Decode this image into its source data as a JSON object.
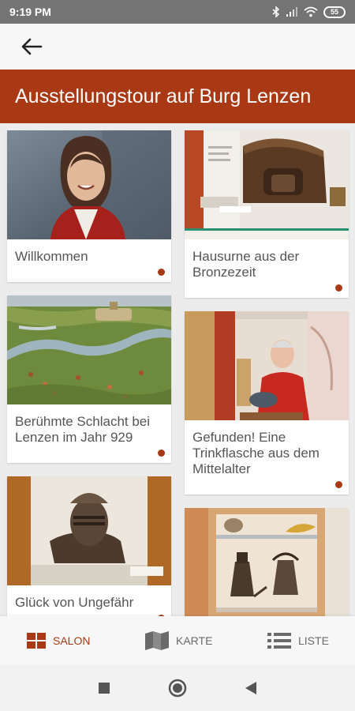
{
  "status_bar": {
    "time": "9:19 PM",
    "battery": "55",
    "icons": [
      "bluetooth-icon",
      "signal-icon",
      "wifi-icon",
      "battery-icon"
    ]
  },
  "app_bar": {
    "back_icon": "arrow-left-icon"
  },
  "header": {
    "title": "Ausstellungstour auf Burg Lenzen"
  },
  "cards": [
    {
      "title": "Willkommen"
    },
    {
      "title": "Hausurne aus der Bronzezeit"
    },
    {
      "title": "Berühmte Schlacht bei Lenzen im Jahr 929"
    },
    {
      "title": "Gefunden! Eine Trinkflasche aus dem Mittelalter"
    },
    {
      "title": "Glück von Ungefähr"
    },
    {
      "title": ""
    }
  ],
  "bottom_nav": {
    "salon": "SALON",
    "karte": "KARTE",
    "liste": "LISTE"
  },
  "colors": {
    "accent": "#a93814",
    "status_bar": "#747474",
    "background": "#ececec",
    "card": "#ffffff"
  }
}
